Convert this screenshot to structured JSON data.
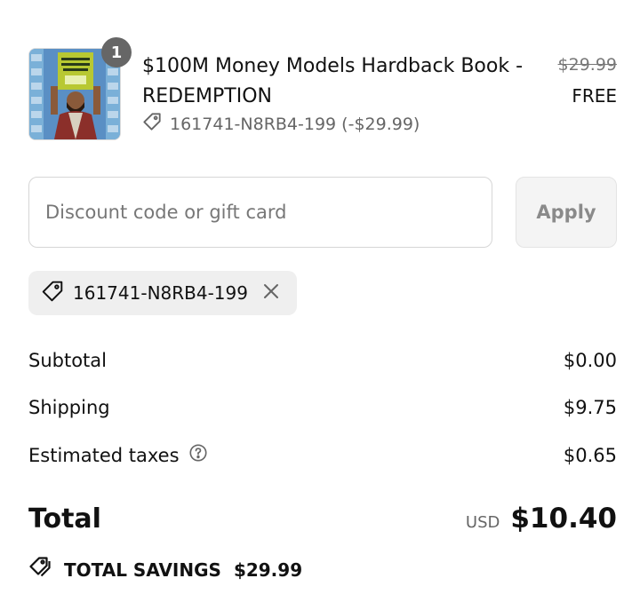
{
  "product": {
    "quantity": "1",
    "title_line1": "$100M Money Models Hardback Book -",
    "title_line2": "REDEMPTION",
    "applied_code": "161741-N8RB4-199 (-$29.99)",
    "original_price": "$29.99",
    "final_price": "FREE"
  },
  "discount": {
    "placeholder": "Discount code or gift card",
    "value": "",
    "apply_label": "Apply",
    "chip_code": "161741-N8RB4-199"
  },
  "summary": {
    "subtotal_label": "Subtotal",
    "subtotal_value": "$0.00",
    "shipping_label": "Shipping",
    "shipping_value": "$9.75",
    "taxes_label": "Estimated taxes",
    "taxes_value": "$0.65",
    "total_label": "Total",
    "currency": "USD",
    "total_value": "$10.40",
    "savings_label": "TOTAL SAVINGS",
    "savings_value": "$29.99"
  },
  "icons": {
    "tag": "tag-icon",
    "help": "question-circle-icon",
    "close": "close-icon",
    "savings": "tag-icon"
  },
  "colors": {
    "text": "#111111",
    "muted": "#666666",
    "badge": "#666666",
    "chip_bg": "#efefef",
    "button_bg": "#f4f4f4"
  }
}
